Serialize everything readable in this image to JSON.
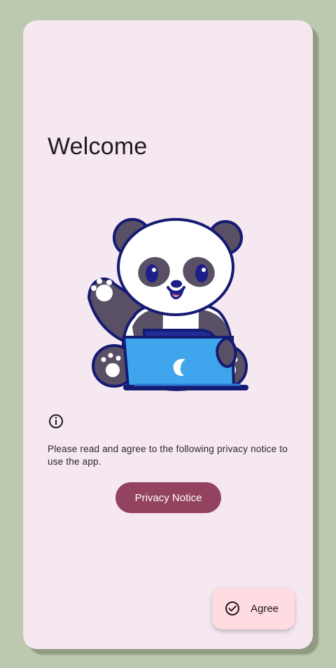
{
  "welcome": {
    "title": "Welcome",
    "illustration": "panda-with-laptop"
  },
  "privacy": {
    "info_icon": "info-icon",
    "notice_text": "Please read and agree to the following privacy notice to use the app.",
    "button_label": "Privacy Notice"
  },
  "fab": {
    "icon": "check-circle-icon",
    "label": "Agree"
  },
  "colors": {
    "background": "#bdc9ae",
    "card": "#f6e8f1",
    "primary_button": "#93425f",
    "fab": "#ffdce2"
  }
}
